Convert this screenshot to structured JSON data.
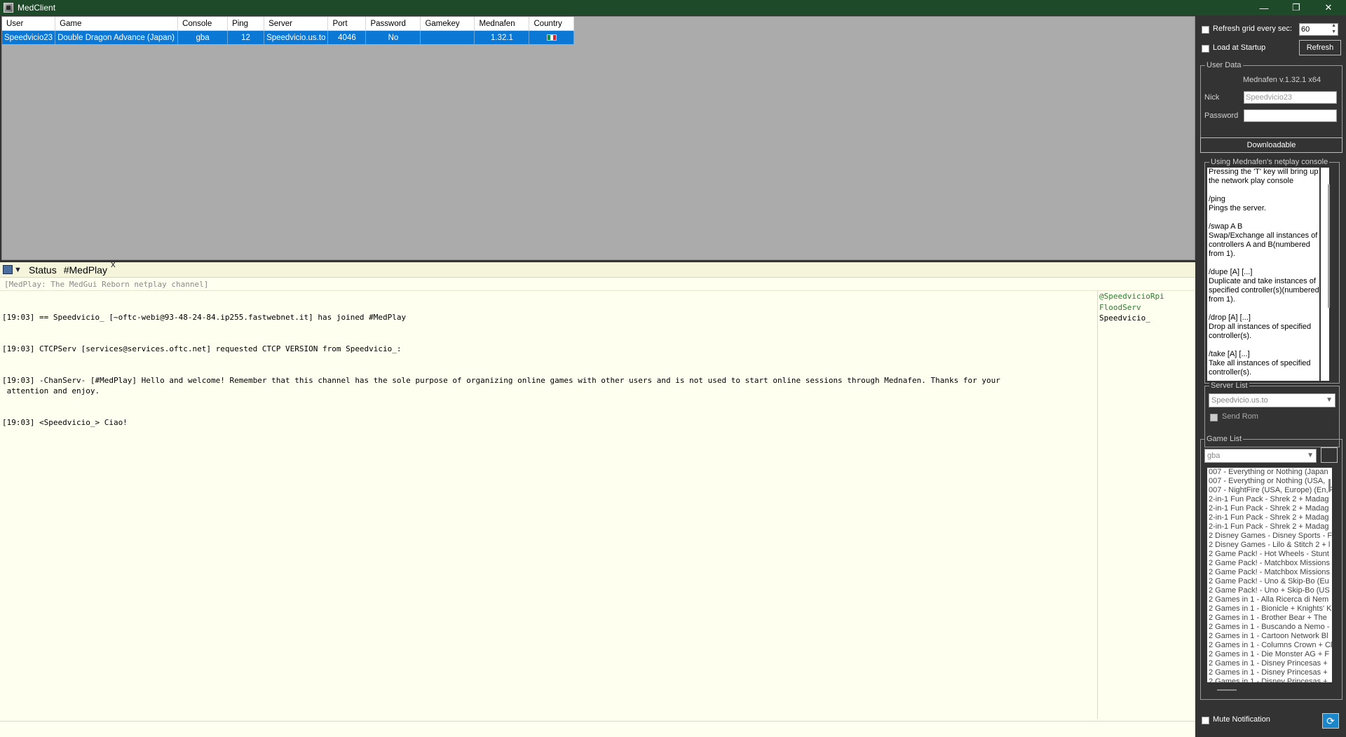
{
  "window": {
    "title": "MedClient",
    "min_icon": "minimize-icon",
    "max_icon": "maximize-icon",
    "close_icon": "close-icon"
  },
  "grid": {
    "columns": [
      "User",
      "Game",
      "Console",
      "Ping",
      "Server",
      "Port",
      "Password",
      "Gamekey",
      "Mednafen",
      "Country"
    ],
    "rows": [
      {
        "user": "Speedvicio23",
        "game": "Double Dragon Advance (Japan)",
        "console": "gba",
        "ping": "12",
        "server": "Speedvicio.us.to",
        "port": "4046",
        "password": "No",
        "gamekey": "",
        "mednafen": "1.32.1",
        "country": "italy-flag"
      }
    ]
  },
  "chat": {
    "tabs": [
      {
        "label": "Status"
      },
      {
        "label": "#MedPlay",
        "active": true
      }
    ],
    "close_label": "X",
    "topic": "[MedPlay: The MedGui Reborn netplay channel]",
    "messages": [
      "[19:03] == Speedvicio_ [~oftc-webi@93-48-24-84.ip255.fastwebnet.it] has joined #MedPlay",
      "[19:03] CTCPServ [services@services.oftc.net] requested CTCP VERSION from Speedvicio_:",
      "[19:03] -ChanServ- [#MedPlay] Hello and welcome! Remember that this channel has the sole purpose of organizing online games with other users and is not used to start online sessions through Mednafen. Thanks for your\n attention and enjoy.",
      "[19:03] <Speedvicio_> Ciao!"
    ],
    "nicks": [
      {
        "name": "@SpeedvicioRpi",
        "op": true
      },
      {
        "name": "FloodServ",
        "op": true
      },
      {
        "name": "Speedvicio_",
        "op": false
      }
    ]
  },
  "right": {
    "refresh_grid_label": "Refresh grid every sec:",
    "refresh_interval": "60",
    "load_at_startup_label": "Load at Startup",
    "refresh_button": "Refresh",
    "user_data": {
      "legend": "User Data",
      "version": "Mednafen v.1.32.1 x64",
      "nick_label": "Nick",
      "nick_value": "Speedvicio23",
      "password_label": "Password",
      "password_value": ""
    },
    "downloadable_button": "Downloadable",
    "help": {
      "legend": "Using Mednafen's netplay console",
      "paragraphs": [
        "Pressing the 'T' key will bring up the network play console",
        "/ping\nPings the server.",
        "/swap A B\nSwap/Exchange all instances of controllers A and B(numbered from 1).",
        "/dupe [A] [...]\nDuplicate and take instances of specified controller(s)(numbered from 1).",
        "/drop [A] [...]\nDrop all instances of specified controller(s).",
        "/take [A] [...]\nTake all instances of specified controller(s)."
      ]
    },
    "server_list": {
      "legend": "Server List",
      "selected": "Speedvicio.us.to",
      "send_rom_label": "Send Rom"
    },
    "game_list": {
      "legend": "Game List",
      "console_selected": "gba",
      "games": [
        "007 - Everything or Nothing (Japan",
        "007 - Everything or Nothing (USA,",
        "007 - NightFire (USA, Europe) (En,F",
        "2-in-1 Fun Pack - Shrek 2 + Madag",
        "2-in-1 Fun Pack - Shrek 2 + Madag",
        "2-in-1 Fun Pack - Shrek 2 + Madag",
        "2-in-1 Fun Pack - Shrek 2 + Madag",
        "2 Disney Games - Disney Sports - F",
        "2 Disney Games - Lilo & Stitch 2 + l",
        "2 Game Pack! - Hot Wheels - Stunt",
        "2 Game Pack! - Matchbox Missions",
        "2 Game Pack! - Matchbox Missions",
        "2 Game Pack! - Uno & Skip-Bo (Eu",
        "2 Game Pack! - Uno + Skip-Bo (US",
        "2 Games in 1 - Alla Ricerca di Nem",
        "2 Games in 1 - Bionicle + Knights' K",
        "2 Games in 1 - Brother Bear + The",
        "2 Games in 1 - Buscando a Nemo -",
        "2 Games in 1 - Cartoon Network Bl",
        "2 Games in 1 - Columns Crown + Cl",
        "2 Games in 1 - Die Monster AG + F",
        "2 Games in 1 - Disney Princesas +",
        "2 Games in 1 - Disney Princesas +",
        "2 Games in 1 - Disney Princesas +"
      ]
    },
    "mute_label": "Mute Notification"
  }
}
